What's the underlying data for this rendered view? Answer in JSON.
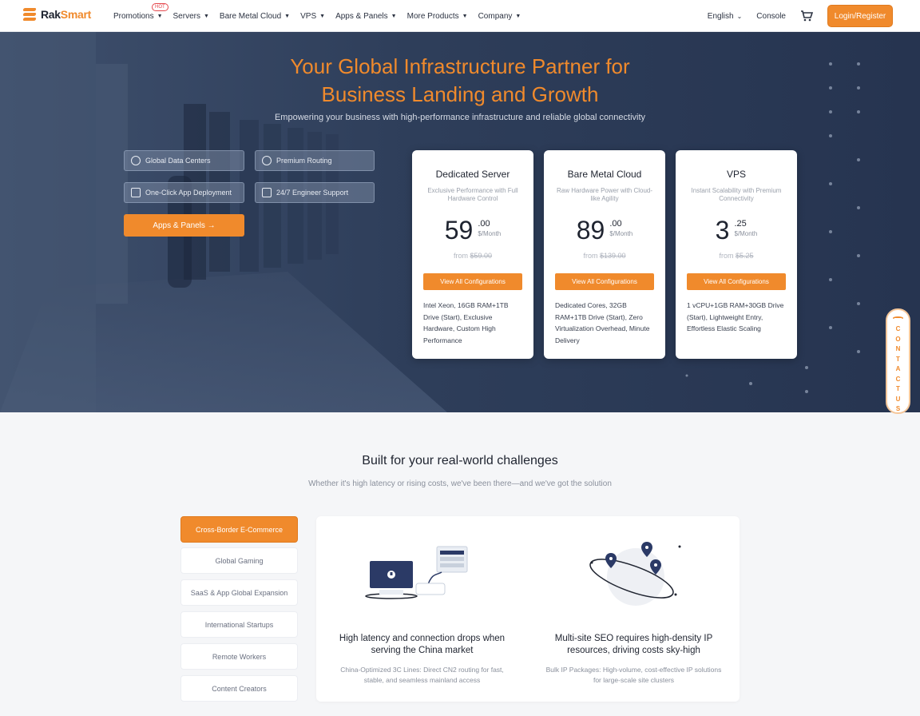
{
  "nav": {
    "logo_prefix": "Rak",
    "logo_accent": "Smart",
    "menu": [
      {
        "label": "Promotions",
        "badge": "HOT"
      },
      {
        "label": "Servers"
      },
      {
        "label": "Bare Metal Cloud"
      },
      {
        "label": "VPS"
      },
      {
        "label": "Apps & Panels"
      },
      {
        "label": "More Products"
      },
      {
        "label": "Company"
      }
    ],
    "language": "English",
    "console": "Console",
    "login": "Login/Register"
  },
  "hero": {
    "title_line1": "Your Global Infrastructure Partner for",
    "title_line2": "Business Landing and Growth",
    "subtitle": "Empowering your business with high-performance infrastructure and reliable global connectivity",
    "features": [
      {
        "label": "Global Data Centers",
        "icon": "globe-icon"
      },
      {
        "label": "Premium Routing",
        "icon": "route-icon"
      },
      {
        "label": "One-Click App Deployment",
        "icon": "app-icon"
      },
      {
        "label": "24/7 Engineer Support",
        "icon": "chat-icon"
      }
    ],
    "apps_button": "Apps & Panels →"
  },
  "cards": [
    {
      "title": "Dedicated Server",
      "desc": "Exclusive Performance with Full Hardware Control",
      "price_int": "59",
      "price_dec": ".00",
      "unit": "$/Month",
      "from_label": "from",
      "old_price": "$59.00",
      "button": "View All Configurations",
      "spec": "Intel Xeon, 16GB RAM+1TB Drive (Start), Exclusive Hardware, Custom High Performance"
    },
    {
      "title": "Bare Metal Cloud",
      "desc": "Raw Hardware Power with Cloud-like Agility",
      "price_int": "89",
      "price_dec": ".00",
      "unit": "$/Month",
      "from_label": "from",
      "old_price": "$139.00",
      "button": "View All Configurations",
      "spec": "Dedicated Cores, 32GB RAM+1TB Drive (Start), Zero Virtualization Overhead, Minute Delivery"
    },
    {
      "title": "VPS",
      "desc": "Instant Scalability with Premium Connectivity",
      "price_int": "3",
      "price_dec": ".25",
      "unit": "$/Month",
      "from_label": "from",
      "old_price": "$5.25",
      "button": "View All Configurations",
      "spec": "1 vCPU+1GB RAM+30GB Drive (Start), Lightweight Entry, Effortless Elastic Scaling"
    }
  ],
  "contact": {
    "letters": [
      "C",
      "O",
      "N",
      "T",
      "A",
      "C",
      "T",
      "U",
      "S"
    ]
  },
  "section": {
    "title": "Built for your real-world challenges",
    "subtitle": "Whether it's high latency or rising costs, we've been there—and we've got the solution",
    "tabs": [
      "Cross-Border E-Commerce",
      "Global Gaming",
      "SaaS & App Global Expansion",
      "International Startups",
      "Remote Workers",
      "Content Creators"
    ],
    "active_tab": 0,
    "columns": [
      {
        "title": "High latency and connection drops when serving the China market",
        "text": "China-Optimized 3C Lines: Direct CN2 routing for fast, stable, and seamless mainland access"
      },
      {
        "title": "Multi-site SEO requires high-density IP resources, driving costs sky-high",
        "text": "Bulk IP Packages: High-volume, cost-effective IP solutions for large-scale site clusters"
      }
    ]
  },
  "colors": {
    "accent": "#f08a2c",
    "hero_bg": "#2b3a55"
  }
}
